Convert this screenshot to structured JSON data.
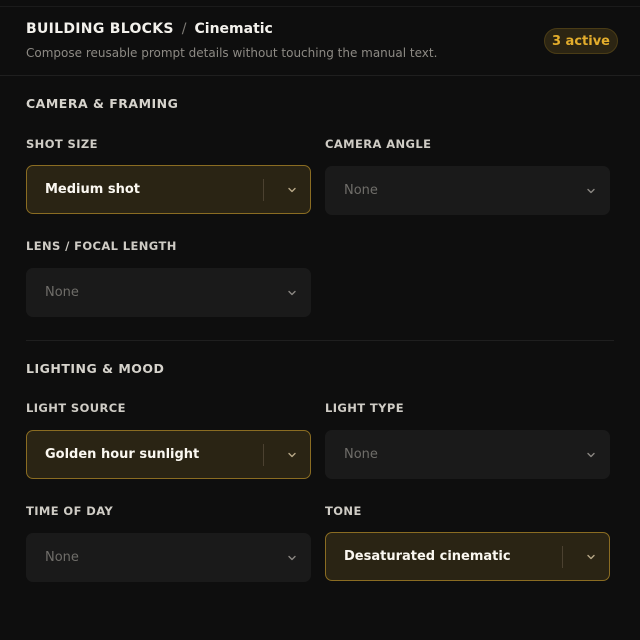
{
  "header": {
    "title": "BUILDING BLOCKS",
    "separator": "/",
    "subtitle_tab": "Cinematic",
    "description": "Compose reusable prompt details without touching the manual text.",
    "badge": "3 active"
  },
  "camera": {
    "section_title": "CAMERA & FRAMING",
    "shot_size": {
      "label": "SHOT SIZE",
      "value": "Medium shot",
      "active": true
    },
    "camera_angle": {
      "label": "CAMERA ANGLE",
      "value": "None",
      "active": false
    },
    "lens": {
      "label": "LENS / FOCAL LENGTH",
      "value": "None",
      "active": false
    }
  },
  "lighting": {
    "section_title": "LIGHTING & MOOD",
    "light_source": {
      "label": "LIGHT SOURCE",
      "value": "Golden hour sunlight",
      "active": true
    },
    "light_type": {
      "label": "LIGHT TYPE",
      "value": "None",
      "active": false
    },
    "time_of_day": {
      "label": "TIME OF DAY",
      "value": "None",
      "active": false
    },
    "tone": {
      "label": "TONE",
      "value": "Desaturated cinematic",
      "active": true
    }
  },
  "colors": {
    "background": "#0e0e0e",
    "accent": "#e3ad2c",
    "active_border": "#8a6c22",
    "active_fill": "#2a2414",
    "inactive_fill": "#1a1a1a"
  },
  "icons": {
    "dropdown": "chevron-down-icon"
  }
}
